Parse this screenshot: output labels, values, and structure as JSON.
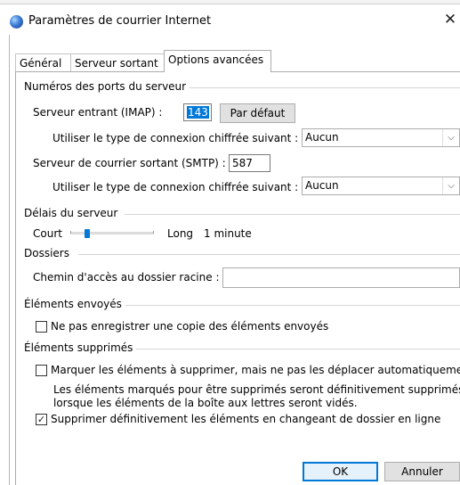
{
  "window": {
    "title": "Paramètres de courrier Internet",
    "close_glyph": "✕"
  },
  "tabs": [
    {
      "label": "Général"
    },
    {
      "label": "Serveur sortant"
    },
    {
      "label": "Options avancées"
    }
  ],
  "ports": {
    "group": "Numéros des ports du serveur",
    "incoming_label": "Serveur entrant (IMAP) :",
    "incoming_value": "143",
    "default_button": "Par défaut",
    "encryption_label_1": "Utiliser le type de connexion chiffrée suivant :",
    "encryption_value_1": "Aucun",
    "outgoing_label": "Serveur de courrier sortant (SMTP) :",
    "outgoing_value": "587",
    "encryption_label_2": "Utiliser le type de connexion chiffrée suivant :",
    "encryption_value_2": "Aucun"
  },
  "timeout": {
    "group": "Délais du serveur",
    "short_label": "Court",
    "long_label": "Long",
    "value_text": "1 minute",
    "slider_level_fraction": 0.2
  },
  "folders": {
    "group": "Dossiers",
    "root_path_label": "Chemin d'accès au dossier racine :",
    "root_path_value": ""
  },
  "sent": {
    "group": "Éléments envoyés",
    "dont_save_label": "Ne pas enregistrer une copie des éléments envoyés",
    "dont_save_checked": false
  },
  "deleted": {
    "group": "Éléments supprimés",
    "mark_label": "Marquer les éléments à supprimer, mais ne pas les déplacer automatiquement",
    "mark_checked": false,
    "note_line1": "Les éléments marqués pour être supprimés seront définitivement supprimés",
    "note_line2": "lorsque les éléments de la boîte aux lettres seront vidés.",
    "purge_label": "Supprimer définitivement les éléments en changeant de dossier en ligne",
    "purge_checked": true
  },
  "footer": {
    "ok": "OK",
    "cancel": "Annuler"
  },
  "colors": {
    "accent": "#0078d7",
    "button_face": "#e1e1e1"
  },
  "icons": {
    "check": "✓",
    "dropdown": "⌵"
  }
}
